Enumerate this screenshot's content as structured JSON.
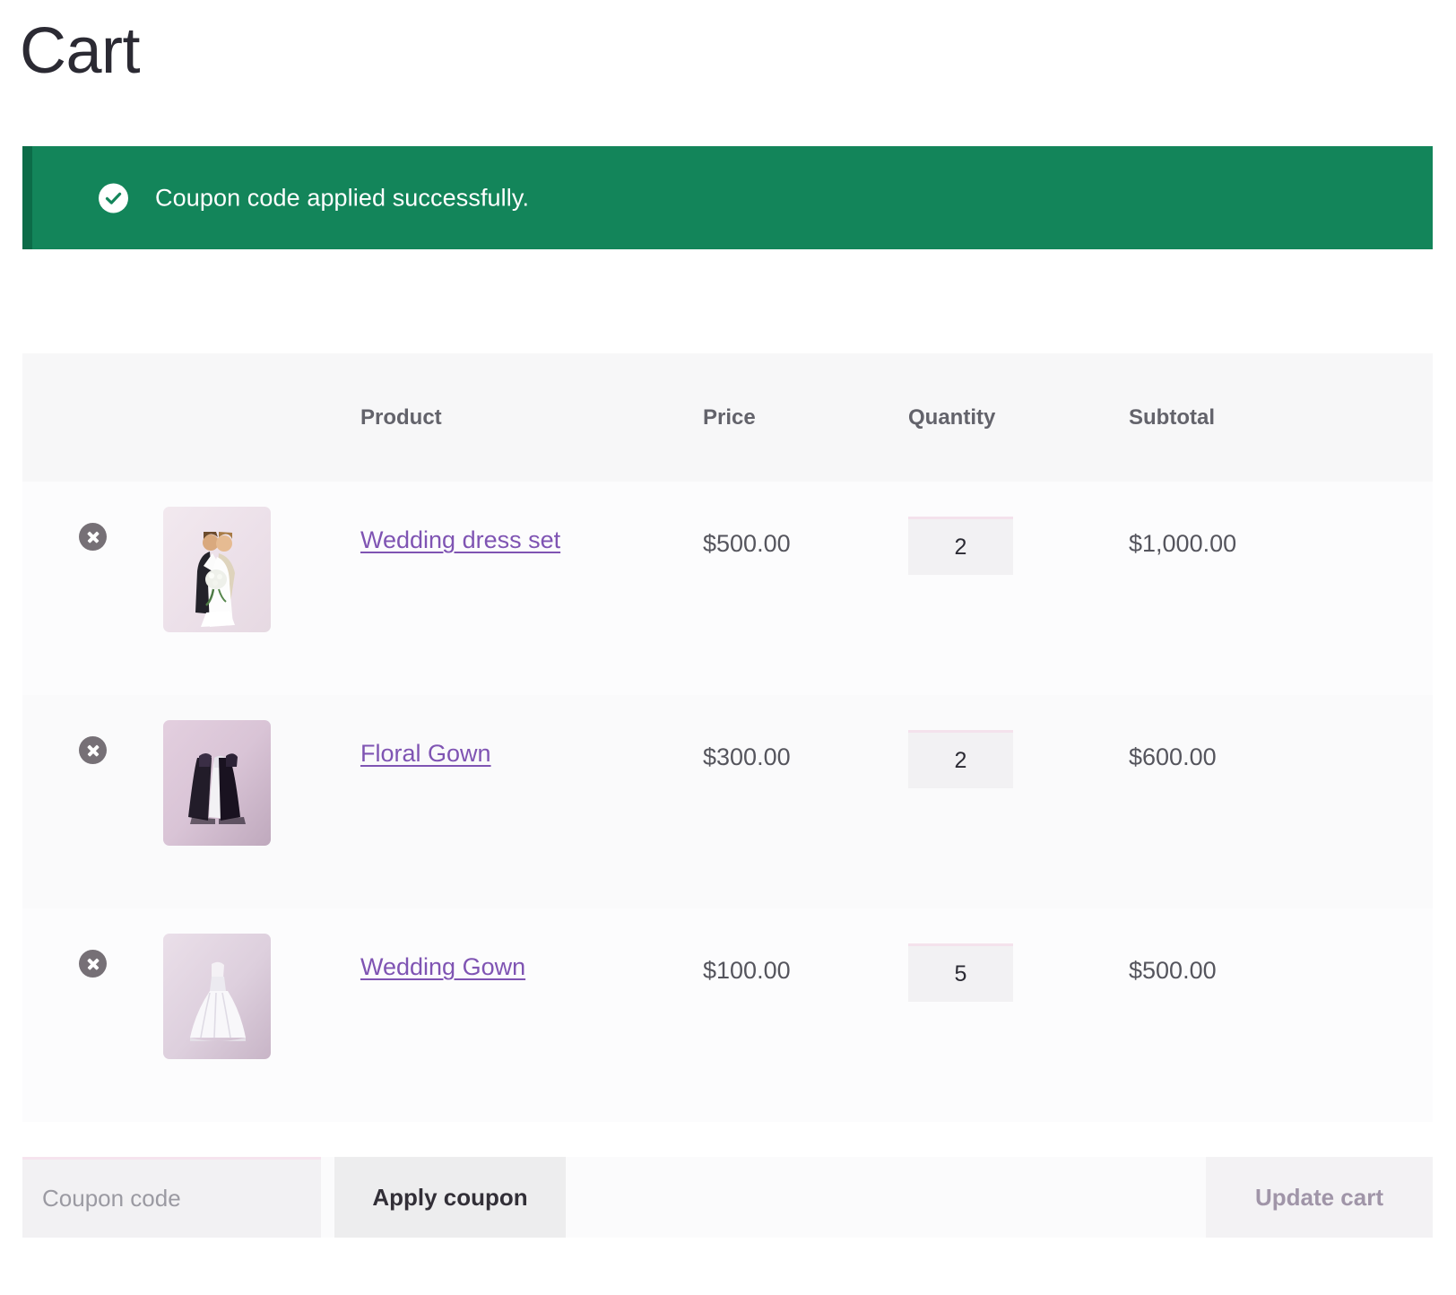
{
  "page": {
    "title": "Cart"
  },
  "notice": {
    "icon": "check-circle-icon",
    "message": "Coupon code applied successfully.",
    "background_color": "#13855a",
    "stripe_color": "#0c6c48",
    "text_color": "#ffffff"
  },
  "table": {
    "headers": {
      "remove": "",
      "thumbnail": "",
      "product": "Product",
      "price": "Price",
      "quantity": "Quantity",
      "subtotal": "Subtotal"
    },
    "rows": [
      {
        "remove_icon": "remove-x-icon",
        "thumbnail": "wedding-couple-photo",
        "name": "Wedding dress set",
        "price": "$500.00",
        "quantity": "2",
        "subtotal": "$1,000.00"
      },
      {
        "remove_icon": "remove-x-icon",
        "thumbnail": "three-gowns-photo",
        "name": "Floral Gown",
        "price": "$300.00",
        "quantity": "2",
        "subtotal": "$600.00"
      },
      {
        "remove_icon": "remove-x-icon",
        "thumbnail": "white-ball-gown-photo",
        "name": "Wedding Gown",
        "price": "$100.00",
        "quantity": "5",
        "subtotal": "$500.00"
      }
    ]
  },
  "footer": {
    "coupon_placeholder": "Coupon code",
    "coupon_value": "",
    "apply_label": "Apply coupon",
    "update_label": "Update cart"
  },
  "colors": {
    "link": "#7f54b3",
    "success": "#13855a",
    "header_text": "#63636b",
    "body_text": "#55555d"
  }
}
